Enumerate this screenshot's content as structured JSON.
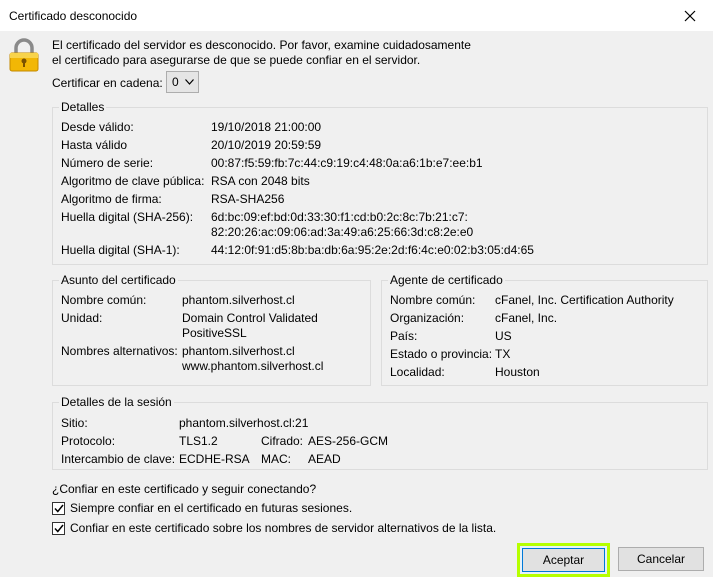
{
  "window": {
    "title": "Certificado desconocido"
  },
  "intro": {
    "line1": "El certificado del servidor es desconocido. Por favor, examine cuidadosamente",
    "line2": "el certificado para asegurarse de que se puede confiar en el servidor."
  },
  "chain": {
    "label": "Certificar en cadena:",
    "value": "0"
  },
  "details": {
    "title": "Detalles",
    "rows": [
      {
        "label": "Desde válido:",
        "value": "19/10/2018 21:00:00"
      },
      {
        "label": "Hasta válido",
        "value": "20/10/2019 20:59:59"
      },
      {
        "label": "Número de serie:",
        "value": "00:87:f5:59:fb:7c:44:c9:19:c4:48:0a:a6:1b:e7:ee:b1"
      },
      {
        "label": "Algoritmo de clave pública:",
        "value": "RSA con 2048 bits"
      },
      {
        "label": "Algoritmo de firma:",
        "value": "RSA-SHA256"
      },
      {
        "label": "Huella digital (SHA-256):",
        "value": "6d:bc:09:ef:bd:0d:33:30:f1:cd:b0:2c:8c:7b:21:c7:",
        "value2": "82:20:26:ac:09:06:ad:3a:49:a6:25:66:3d:c8:2e:e0"
      },
      {
        "label": "Huella digital (SHA-1):",
        "value": "44:12:0f:91:d5:8b:ba:db:6a:95:2e:2d:f6:4c:e0:02:b3:05:d4:65"
      }
    ]
  },
  "subject": {
    "title": "Asunto del certificado",
    "common_name_label": "Nombre común:",
    "common_name": "phantom.silverhost.cl",
    "unit_label": "Unidad:",
    "unit_line1": "Domain Control Validated",
    "unit_line2": "PositiveSSL",
    "alt_label": "Nombres alternativos:",
    "alt_line1": "phantom.silverhost.cl",
    "alt_line2": "www.phantom.silverhost.cl"
  },
  "issuer": {
    "title": "Agente de certificado",
    "rows": [
      {
        "label": "Nombre común:",
        "value": "cFanel, Inc. Certification Authority"
      },
      {
        "label": "Organización:",
        "value": "cFanel, Inc."
      },
      {
        "label": "País:",
        "value": "US"
      },
      {
        "label": "Estado o provincia:",
        "value": "TX"
      },
      {
        "label": "Localidad:",
        "value": "Houston"
      }
    ]
  },
  "session": {
    "title": "Detalles de la sesión",
    "site_label": "Sitio:",
    "site": "phantom.silverhost.cl:21",
    "protocol_label": "Protocolo:",
    "protocol": "TLS1.2",
    "cipher_label": "Cifrado:",
    "cipher": "AES-256-GCM",
    "kex_label": "Intercambio de clave:",
    "kex": "ECDHE-RSA",
    "mac_label": "MAC:",
    "mac": "AEAD"
  },
  "footer": {
    "question": "¿Confiar en este certificado y seguir conectando?",
    "check1": {
      "label": "Siempre confiar en el certificado en futuras sesiones.",
      "checked": true
    },
    "check2": {
      "label": "Confiar en este certificado sobre los nombres de servidor alternativos de la lista.",
      "checked": true
    }
  },
  "buttons": {
    "accept": "Aceptar",
    "cancel": "Cancelar"
  },
  "colors": {
    "highlight": "#b6ff00",
    "lock_gold": "#f2b705"
  }
}
